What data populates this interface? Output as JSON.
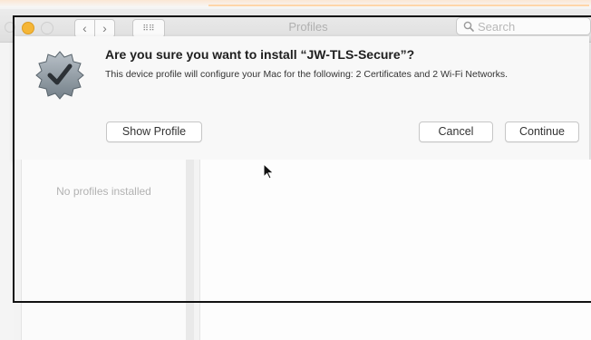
{
  "window": {
    "title": "Profiles",
    "search_placeholder": "Search",
    "navigation": {
      "back_icon": "chevron-left-icon",
      "forward_icon": "chevron-right-icon",
      "show_all_icon": "grid-icon"
    }
  },
  "dialog": {
    "icon": "profile-badge-checkmark-icon",
    "heading": "Are you sure you want to install “JW-TLS-Secure”?",
    "message": "This device profile will configure your Mac for the following: 2 Certificates and 2 Wi-Fi Networks.",
    "buttons": {
      "show_profile": "Show Profile",
      "cancel": "Cancel",
      "continue": "Continue"
    }
  },
  "profiles_list": {
    "empty_text": "No profiles installed"
  },
  "colors": {
    "minimize_button": "#f5b637",
    "annotation_border": "#111111"
  }
}
